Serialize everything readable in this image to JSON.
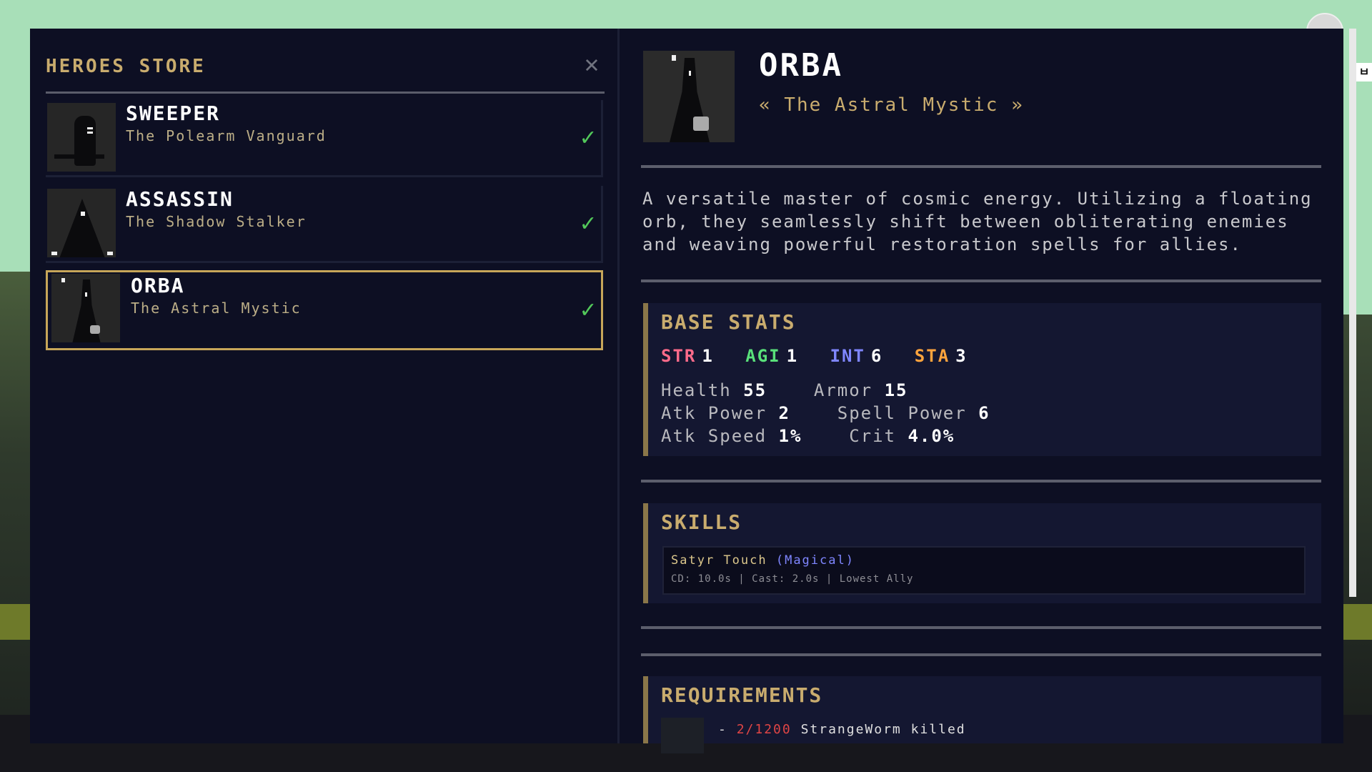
{
  "store": {
    "title": "HEROES STORE",
    "close_icon": "✕"
  },
  "heroes": [
    {
      "name": "SWEEPER",
      "subtitle": "The Polearm Vanguard",
      "owned": true,
      "check": "✓"
    },
    {
      "name": "ASSASSIN",
      "subtitle": "The Shadow Stalker",
      "owned": true,
      "check": "✓"
    },
    {
      "name": "ORBA",
      "subtitle": "The Astral Mystic",
      "owned": true,
      "selected": true,
      "check": "✓"
    }
  ],
  "detail": {
    "name": "ORBA",
    "subtitle": "« The Astral Mystic »",
    "description": "A versatile master of cosmic energy. Utilizing a floating orb, they seamlessly shift between obliterating enemies and weaving powerful restoration spells for allies.",
    "base_stats": {
      "title": "BASE STATS",
      "attributes": [
        {
          "label": "STR",
          "value": "1",
          "color": "#ff6b8a"
        },
        {
          "label": "AGI",
          "value": "1",
          "color": "#59e07a"
        },
        {
          "label": "INT",
          "value": "6",
          "color": "#7f86ff"
        },
        {
          "label": "STA",
          "value": "3",
          "color": "#ffa43d"
        }
      ],
      "health_label": "Health",
      "health": "55",
      "armor_label": "Armor",
      "armor": "15",
      "atk_power_label": "Atk Power",
      "atk_power": "2",
      "spell_power_label": "Spell Power",
      "spell_power": "6",
      "atk_speed_label": "Atk Speed",
      "atk_speed": "1%",
      "crit_label": "Crit",
      "crit": "4.0%"
    },
    "skills": {
      "title": "SKILLS",
      "items": [
        {
          "name": "Satyr Touch",
          "type": "(Magical)",
          "meta": "CD: 10.0s  |  Cast: 2.0s  |  Lowest Ally"
        }
      ]
    },
    "requirements": {
      "title": "REQUIREMENTS",
      "items": [
        {
          "prefix": "-",
          "progress": "2/1200",
          "text": "StrangeWorm killed"
        }
      ]
    }
  },
  "colors": {
    "accent_gold": "#c9ac6e",
    "selected_border": "#c7a659",
    "check_green": "#52c85a",
    "panel_bg": "#0d0f23",
    "skill_type": "#7f86ff"
  }
}
